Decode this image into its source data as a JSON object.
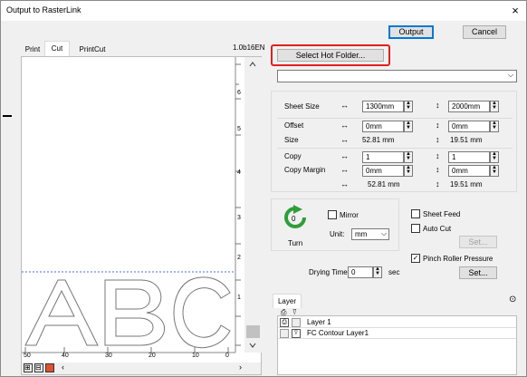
{
  "window": {
    "title": "Output to RasterLink",
    "close": "×"
  },
  "buttons": {
    "output": "Output",
    "cancel": "Cancel",
    "select_hot_folder": "Select Hot Folder...",
    "set_1": "Set...",
    "set_2": "Set..."
  },
  "tabs": [
    {
      "label": "Print"
    },
    {
      "label": "Cut"
    },
    {
      "label": "PrintCut"
    }
  ],
  "version": "1.0b16EN",
  "preview": {
    "text": "ABC",
    "ruler_v": [
      "6",
      "5",
      "4",
      "3",
      "2",
      "1"
    ],
    "ruler_h": [
      "50",
      "40",
      "30",
      "20",
      "10",
      "0"
    ]
  },
  "sheet_size": {
    "label": "Sheet Size",
    "width": "1300mm",
    "height": "2000mm"
  },
  "offset": {
    "label": "Offset",
    "x": "0mm",
    "y": "0mm"
  },
  "size": {
    "label": "Size",
    "x": "52.81 mm",
    "y": "19.51 mm"
  },
  "copy": {
    "label": "Copy",
    "x": "1",
    "y": "1"
  },
  "copy_margin": {
    "label": "Copy Margin",
    "x": "0mm",
    "y": "0mm"
  },
  "total": {
    "x": "52.81 mm",
    "y": "19.51 mm"
  },
  "turn": {
    "label": "Turn",
    "value": "0"
  },
  "mirror": {
    "label": "Mirror",
    "checked": false
  },
  "unit": {
    "label": "Unit:",
    "value": "mm"
  },
  "sheet_feed": {
    "label": "Sheet Feed",
    "checked": false
  },
  "auto_cut": {
    "label": "Auto Cut",
    "checked": false
  },
  "pinch_roller": {
    "label": "Pinch Roller Pressure",
    "checked": true
  },
  "drying": {
    "label": "Drying Time",
    "value": "0",
    "unit": "sec"
  },
  "layer": {
    "tab": "Layer",
    "items": [
      {
        "name": "Layer 1"
      },
      {
        "name": "FC Contour Layer1"
      }
    ]
  },
  "colors": {
    "highlight": "#e02020",
    "accent": "#0078d7",
    "turn_icon": "#2f9e3a"
  }
}
